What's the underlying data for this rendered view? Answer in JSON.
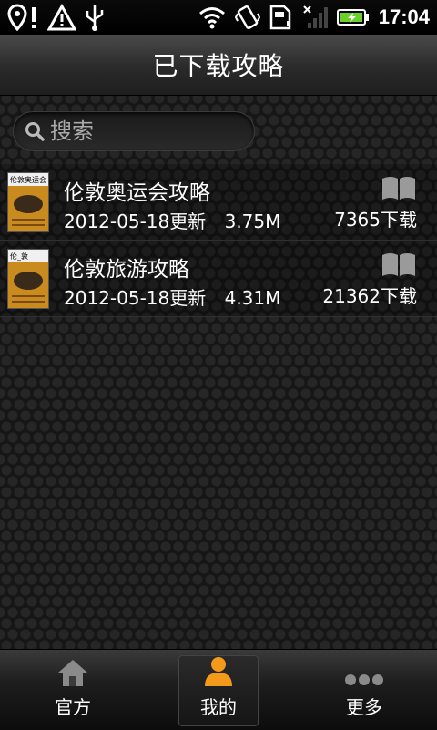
{
  "status_bar": {
    "time": "17:04"
  },
  "header": {
    "title": "已下载攻略"
  },
  "search": {
    "placeholder": "搜索"
  },
  "guides": [
    {
      "title": "伦敦奥运会攻略",
      "date": "2012-05-18更新",
      "size": "3.75M",
      "downloads": "7365下载",
      "thumb_label": "伦敦奥运会"
    },
    {
      "title": "伦敦旅游攻略",
      "date": "2012-05-18更新",
      "size": "4.31M",
      "downloads": "21362下载",
      "thumb_label": "伦_敦"
    }
  ],
  "tabs": [
    {
      "label": "官方",
      "icon": "home-icon"
    },
    {
      "label": "我的",
      "icon": "user-icon"
    },
    {
      "label": "更多",
      "icon": "more-icon"
    }
  ],
  "colors": {
    "accent": "#f39a1c",
    "battery": "#6ad02a"
  }
}
